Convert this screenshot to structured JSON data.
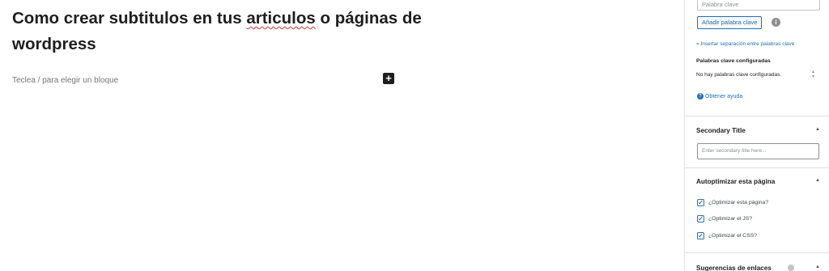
{
  "editor": {
    "title_part1": "Como crear subtitulos en tus ",
    "title_misspelled": "articulos",
    "title_part2": " o páginas de wordpress",
    "block_placeholder": "Teclea / para elegir un bloque",
    "inserter_symbol": "+"
  },
  "sidebar": {
    "keywords": {
      "input_placeholder": "Palabra clave",
      "add_button": "Añadir palabra clave",
      "insert_separation_link": "» Insertar separación entre palabras clave",
      "configured_label": "Palabras clave configuradas",
      "none_configured": "No hay palabras clave configuradas.",
      "help_link": "Obtener ayuda"
    },
    "secondary_title": {
      "header": "Secondary Title",
      "input_placeholder": "Enter secondary title here..."
    },
    "autoptimize": {
      "header": "Autoptimizar esta página",
      "options": [
        {
          "label": "¿Optimizar esta página?",
          "checked": true
        },
        {
          "label": "¿Optimizar el JS?",
          "checked": true
        },
        {
          "label": "¿Optimizar el CSS?",
          "checked": true
        }
      ]
    },
    "link_suggestions": {
      "header": "Sugerencias de enlaces"
    }
  },
  "icons": {
    "inserter": "plus-icon",
    "info": "info-icon",
    "help": "question-icon",
    "chevron": "chevron-up-icon",
    "check": "checkmark-icon"
  },
  "colors": {
    "accent": "#2271b1",
    "text": "#1e1e1e",
    "placeholder": "#757575",
    "spellcheck": "#d63638"
  }
}
